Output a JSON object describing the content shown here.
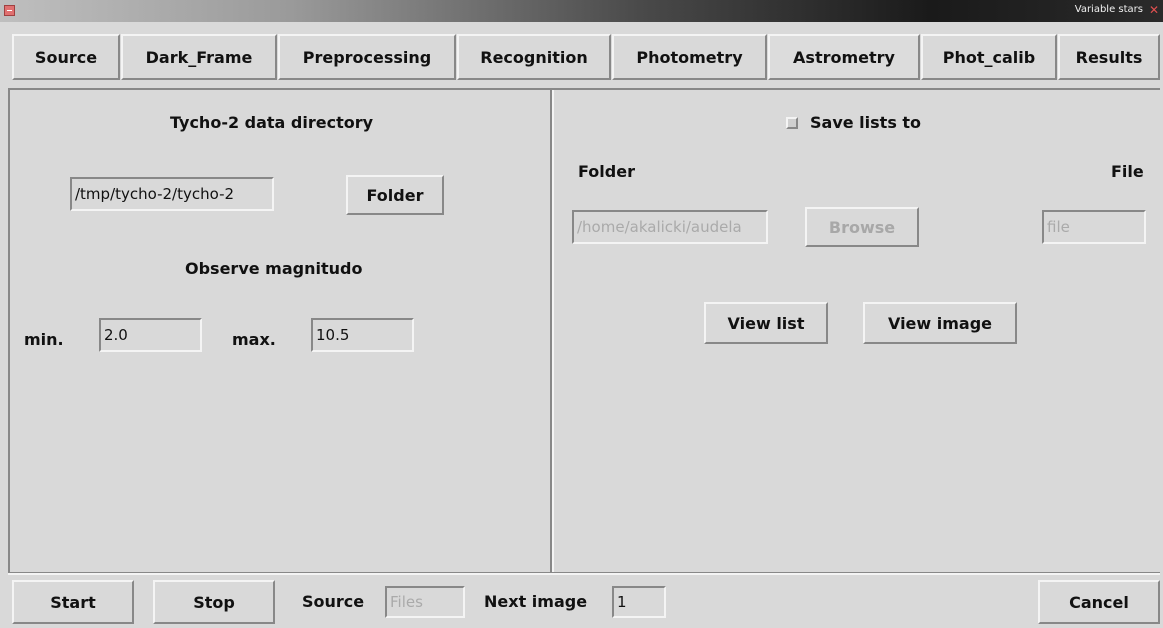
{
  "window": {
    "title": "Variable stars"
  },
  "tabs": [
    {
      "label": "Source"
    },
    {
      "label": "Dark_Frame"
    },
    {
      "label": "Preprocessing"
    },
    {
      "label": "Recognition"
    },
    {
      "label": "Photometry"
    },
    {
      "label": "Astrometry"
    },
    {
      "label": "Phot_calib"
    },
    {
      "label": "Results"
    }
  ],
  "active_tab": "Astrometry",
  "left_panel": {
    "tycho_heading": "Tycho-2 data directory",
    "tycho_path": "/tmp/tycho-2/tycho-2",
    "folder_button": "Folder",
    "magnitude_heading": "Observe magnitudo",
    "min_label": "min.",
    "min_value": "2.0",
    "max_label": "max.",
    "max_value": "10.5"
  },
  "right_panel": {
    "save_lists_label": "Save lists to",
    "save_lists_checked": false,
    "folder_label": "Folder",
    "file_label": "File",
    "folder_path": "/home/akalicki/audela",
    "browse_button": "Browse",
    "file_value": "file",
    "view_list_button": "View list",
    "view_image_button": "View image"
  },
  "bottom_bar": {
    "start_button": "Start",
    "stop_button": "Stop",
    "source_label": "Source",
    "source_value": "Files",
    "next_image_label": "Next image",
    "next_image_value": "1",
    "cancel_button": "Cancel"
  },
  "colors": {
    "background": "#d9d9d9",
    "disabled_text": "#aaaaaa"
  }
}
